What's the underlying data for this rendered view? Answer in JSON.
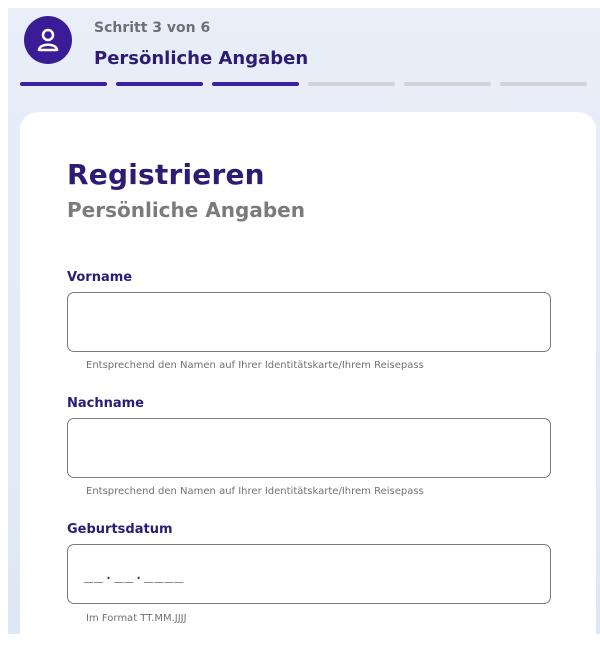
{
  "header": {
    "step_small": "Schritt 3 von 6",
    "step_title": "Persönliche Angaben",
    "icon": "user-icon",
    "progress": {
      "total_steps": 6,
      "active_steps": 3
    }
  },
  "form": {
    "title": "Registrieren",
    "subtitle": "Persönliche Angaben",
    "fields": [
      {
        "label": "Vorname",
        "value": "",
        "placeholder": "",
        "hint": "Entsprechend den Namen auf Ihrer Identitätskarte/Ihrem Reisepass"
      },
      {
        "label": "Nachname",
        "value": "",
        "placeholder": "",
        "hint": "Entsprechend den Namen auf Ihrer Identitätskarte/Ihrem Reisepass"
      },
      {
        "label": "Geburtsdatum",
        "value": "",
        "placeholder": "__.__.____",
        "hint": "Im Format TT.MM.JJJJ"
      }
    ]
  },
  "colors": {
    "brand": "#2d1b74",
    "progress_active": "#3a22a4",
    "progress_inactive": "#d1d3d8"
  }
}
